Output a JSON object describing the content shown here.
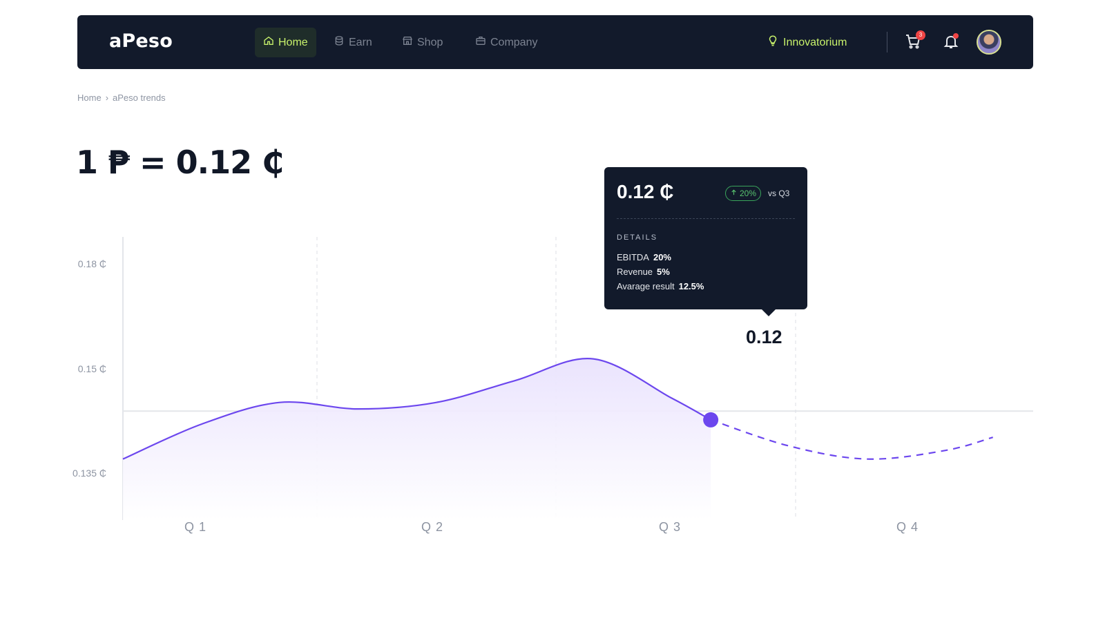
{
  "nav": {
    "logo": "aPeso",
    "items": [
      {
        "label": "Home",
        "icon": "home-icon",
        "active": true
      },
      {
        "label": "Earn",
        "icon": "coins-icon",
        "active": false
      },
      {
        "label": "Shop",
        "icon": "store-icon",
        "active": false
      },
      {
        "label": "Company",
        "icon": "briefcase-icon",
        "active": false
      }
    ],
    "innovatorium": "Innovatorium",
    "cart_count": "3",
    "colors": {
      "bg": "#121a2b",
      "accent": "#c8f26b",
      "badge": "#ef4444"
    }
  },
  "breadcrumb": {
    "home": "Home",
    "separator": "›",
    "current": "aPeso trends"
  },
  "rate": {
    "text": "1 ₱ = 0.12 ₵"
  },
  "tooltip": {
    "value": "0.12 ₵",
    "change": "20%",
    "compare": "vs Q3",
    "details_title": "DETAILS",
    "rows": [
      {
        "label": "EBITDA",
        "value": "20%"
      },
      {
        "label": "Revenue",
        "value": "5%"
      },
      {
        "label": "Avarage result",
        "value": "12.5%"
      }
    ]
  },
  "chart_data": {
    "type": "line",
    "categories": [
      "Q 1",
      "Q 2",
      "Q 3",
      "Q 4"
    ],
    "y_ticks": [
      "0.18 ₵",
      "0.15 ₵",
      "0.135 ₵"
    ],
    "ylim": [
      0.125,
      0.19
    ],
    "highlight": {
      "label": "0.12",
      "x": 3.75,
      "y": 0.148
    },
    "series": [
      {
        "style": "solid",
        "points": [
          [
            0.0,
            0.139
          ],
          [
            0.5,
            0.147
          ],
          [
            1.0,
            0.152
          ],
          [
            1.5,
            0.1505
          ],
          [
            2.0,
            0.152
          ],
          [
            2.5,
            0.157
          ],
          [
            3.0,
            0.162
          ],
          [
            3.5,
            0.153
          ],
          [
            3.75,
            0.148
          ]
        ]
      },
      {
        "style": "dashed",
        "points": [
          [
            3.75,
            0.148
          ],
          [
            4.25,
            0.142
          ],
          [
            4.75,
            0.139
          ],
          [
            5.25,
            0.141
          ],
          [
            5.55,
            0.144
          ]
        ]
      }
    ],
    "colors": {
      "line": "#6c47ee",
      "fill": "#efeafd"
    }
  }
}
